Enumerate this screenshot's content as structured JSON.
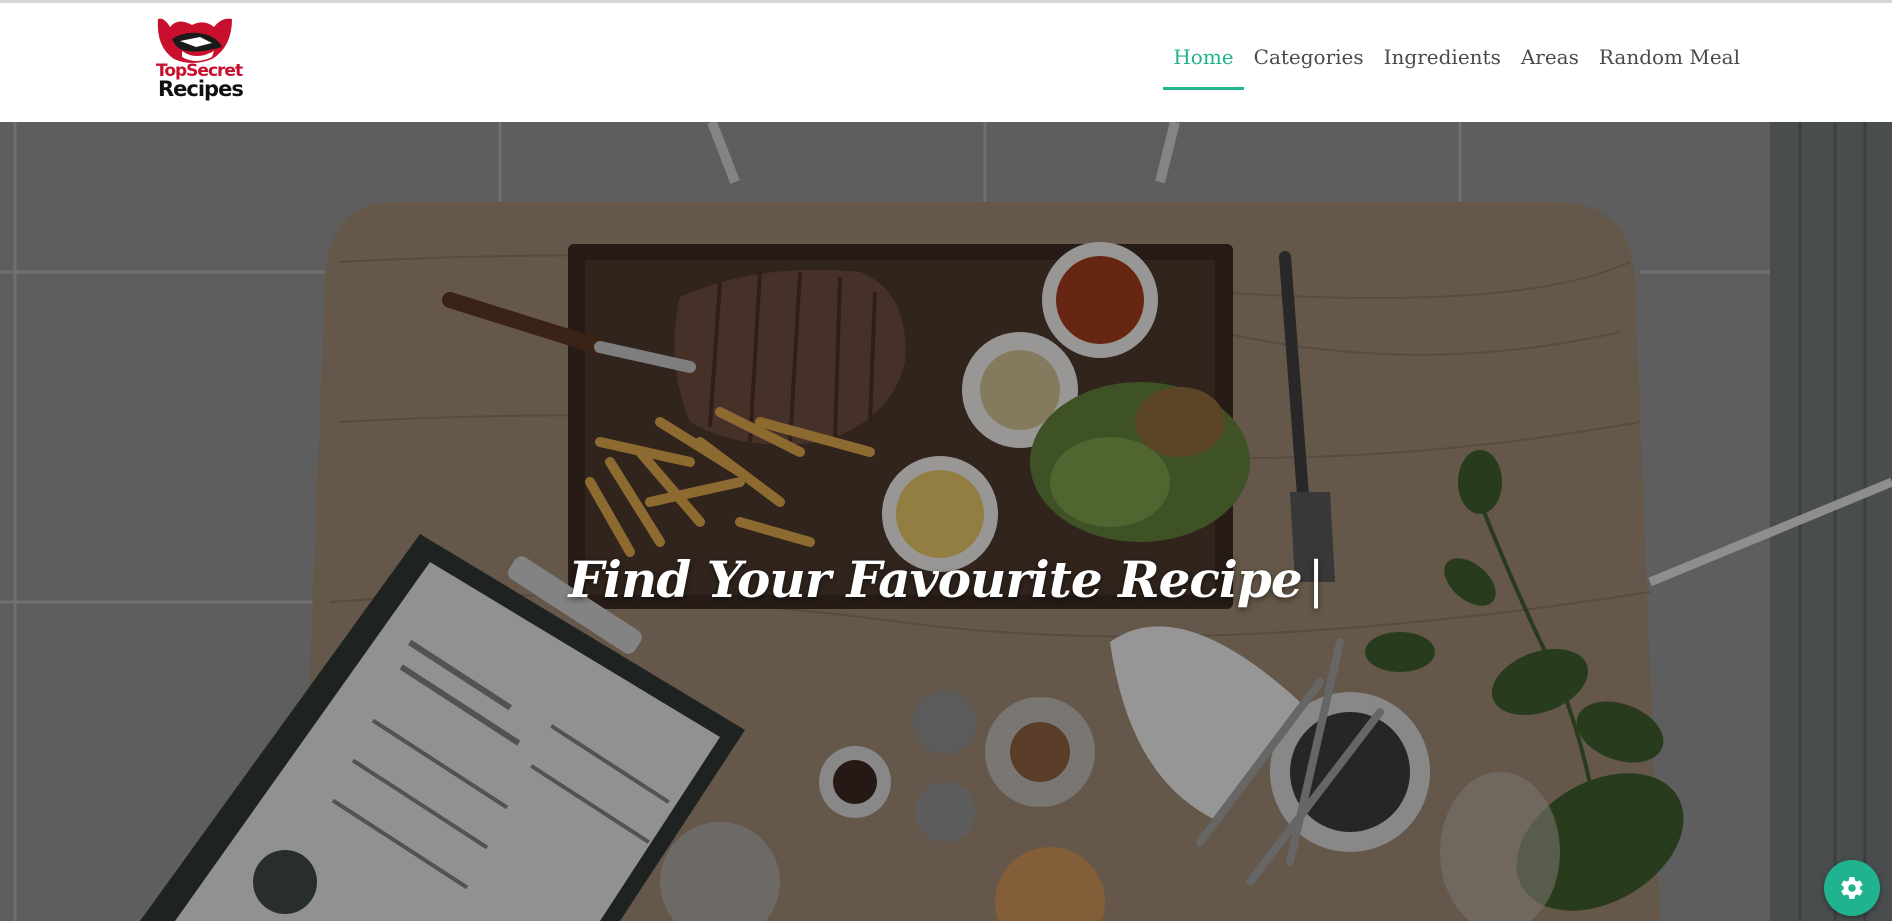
{
  "logo": {
    "line1": "TopSecret",
    "line2": "Recipes",
    "accent_color": "#c8102e"
  },
  "nav": {
    "items": [
      {
        "label": "Home",
        "active": true
      },
      {
        "label": "Categories",
        "active": false
      },
      {
        "label": "Ingredients",
        "active": false
      },
      {
        "label": "Areas",
        "active": false
      },
      {
        "label": "Random Meal",
        "active": false
      }
    ],
    "active_color": "#20b390"
  },
  "hero": {
    "title": "Find Your Favourite Recipe",
    "cursor": "|",
    "background": "top-down photo of a wooden table with steak, fries, sauces, salad, menu clipboard and cutlery"
  },
  "settings_button": {
    "icon": "gear-icon",
    "color": "#20b390"
  }
}
